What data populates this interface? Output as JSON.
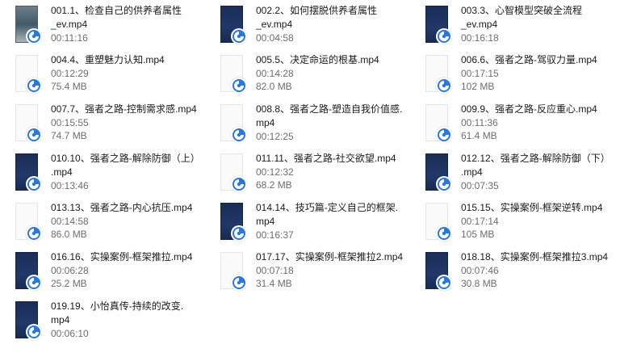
{
  "files": [
    {
      "name_line1": "001.1、检查自己的供养者属性",
      "name_line2": "_ev.mp4",
      "duration": "00:11:16",
      "size": "",
      "thumb": "photo"
    },
    {
      "name_line1": "002.2、如何摆脱供养者属性",
      "name_line2": "_ev.mp4",
      "duration": "00:04:58",
      "size": "",
      "thumb": "dark"
    },
    {
      "name_line1": "003.3、心智模型突破全流程",
      "name_line2": "_ev.mp4",
      "duration": "00:16:18",
      "size": "",
      "thumb": "dark"
    },
    {
      "name_line1": "004.4、重塑魅力认知.mp4",
      "name_line2": "",
      "duration": "00:12:29",
      "size": "75.4 MB",
      "thumb": "blank"
    },
    {
      "name_line1": "005.5、决定命运的根基.mp4",
      "name_line2": "",
      "duration": "00:14:28",
      "size": "82.0 MB",
      "thumb": "blank"
    },
    {
      "name_line1": "006.6、强者之路-驾驭力量.mp4",
      "name_line2": "",
      "duration": "00:17:15",
      "size": "102 MB",
      "thumb": "blank"
    },
    {
      "name_line1": "007.7、强者之路-控制需求感.mp4",
      "name_line2": "",
      "duration": "00:15:55",
      "size": "74.7 MB",
      "thumb": "blank"
    },
    {
      "name_line1": "008.8、强者之路-塑造自我价值感.",
      "name_line2": "mp4",
      "duration": "00:12:25",
      "size": "",
      "thumb": "blank"
    },
    {
      "name_line1": "009.9、强者之路-反应重心.mp4",
      "name_line2": "",
      "duration": "00:11:36",
      "size": "61.4 MB",
      "thumb": "blank"
    },
    {
      "name_line1": "010.10、强者之路-解除防御（上）",
      "name_line2": ".mp4",
      "duration": "00:13:46",
      "size": "",
      "thumb": "dark"
    },
    {
      "name_line1": "011.11、强者之路-社交欲望.mp4",
      "name_line2": "",
      "duration": "00:12:32",
      "size": "68.2 MB",
      "thumb": "blank"
    },
    {
      "name_line1": "012.12、强者之路-解除防御（下）",
      "name_line2": ".mp4",
      "duration": "00:07:35",
      "size": "",
      "thumb": "dark"
    },
    {
      "name_line1": "013.13、强者之路-内心抗压.mp4",
      "name_line2": "",
      "duration": "00:14:58",
      "size": "86.0 MB",
      "thumb": "blank"
    },
    {
      "name_line1": "014.14、技巧篇-定义自己的框架.",
      "name_line2": "mp4",
      "duration": "00:16:37",
      "size": "",
      "thumb": "dark"
    },
    {
      "name_line1": "015.15、实操案例-框架逆转.mp4",
      "name_line2": "",
      "duration": "00:17:14",
      "size": "105 MB",
      "thumb": "blank"
    },
    {
      "name_line1": "016.16、实操案例-框架推拉.mp4",
      "name_line2": "",
      "duration": "00:06:28",
      "size": "25.2 MB",
      "thumb": "dark"
    },
    {
      "name_line1": "017.17、实操案例-框架推拉2.mp4",
      "name_line2": "",
      "duration": "00:07:18",
      "size": "31.4 MB",
      "thumb": "blank"
    },
    {
      "name_line1": "018.18、实操案例-框架推拉3.mp4",
      "name_line2": "",
      "duration": "00:07:46",
      "size": "30.8 MB",
      "thumb": "dark"
    },
    {
      "name_line1": "019.19、小怡真传-持续的改变.",
      "name_line2": "mp4",
      "duration": "00:06:10",
      "size": "",
      "thumb": "dark"
    }
  ],
  "colors": {
    "badge_blue": "#2b78d8",
    "text": "#1a1a1a",
    "meta": "#6d6d6d"
  },
  "icons": {
    "badge": "media-play-badge-icon"
  }
}
